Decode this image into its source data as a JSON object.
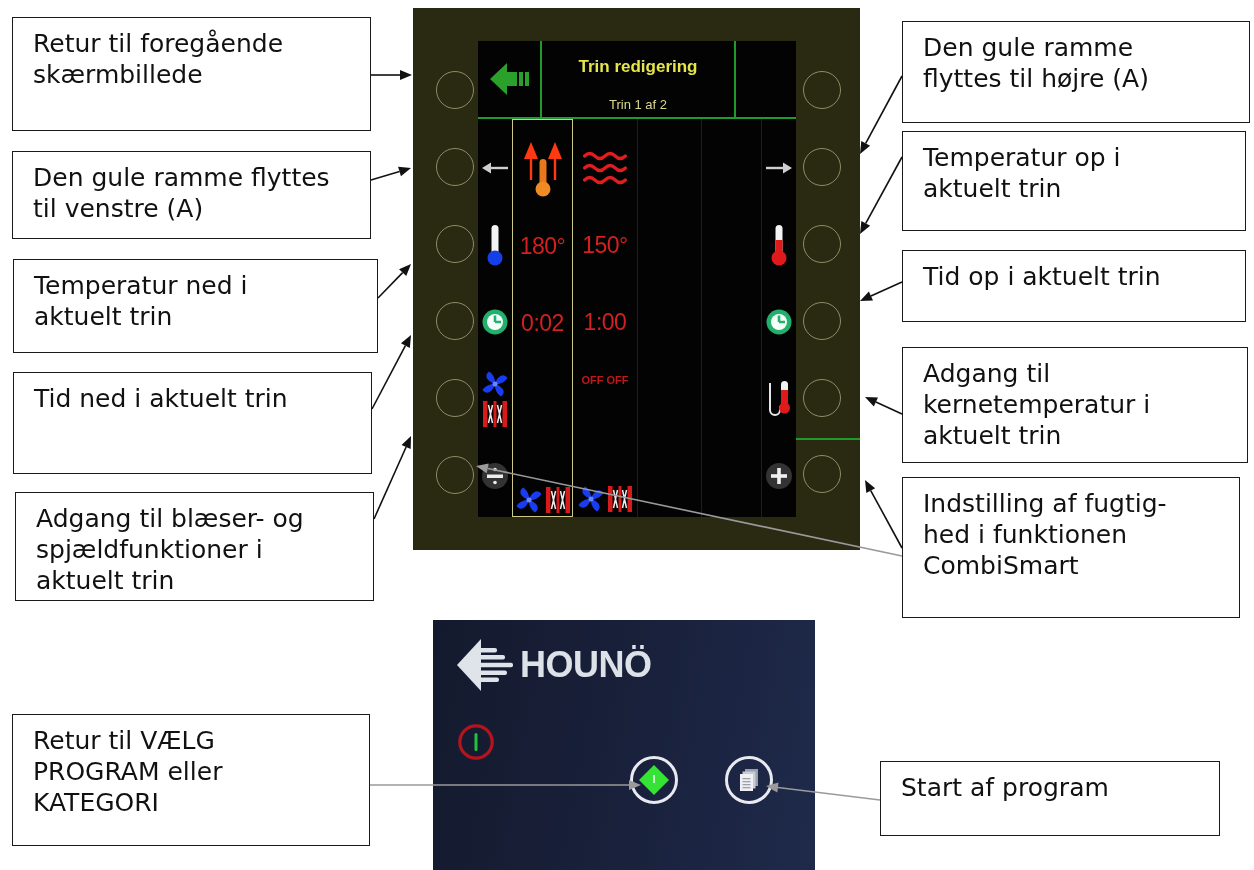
{
  "left_callouts": [
    {
      "lines": [
        "Retur til foregående",
        "skærmbillede"
      ]
    },
    {
      "lines": [
        "Den gule ramme flyttes",
        "til venstre (A)"
      ]
    },
    {
      "lines": [
        "Temperatur ned i",
        "aktuelt trin"
      ]
    },
    {
      "lines": [
        "Tid ned i aktuelt trin"
      ]
    },
    {
      "lines": [
        "Adgang til blæser- og",
        "spjældfunktioner i",
        "aktuelt trin"
      ]
    }
  ],
  "screen": {
    "title": "Trin redigering",
    "subtitle": "Trin 1 af 2",
    "steps": [
      {
        "kind": "heatup",
        "selected": true,
        "temperature": "180°",
        "time": "0:02",
        "fan_damper": true
      },
      {
        "kind": "waves",
        "selected": false,
        "temperature": "150°",
        "time": "1:00",
        "status": "OFF OFF",
        "fan_damper": true
      },
      {
        "selected": false,
        "fan_damper": false
      },
      {
        "selected": false,
        "fan_damper": false
      }
    ]
  },
  "right_callouts": [
    {
      "lines": [
        "Den gule ramme",
        "flyttes til højre (A)"
      ]
    },
    {
      "lines": [
        "Temperatur op i",
        "aktuelt trin"
      ]
    },
    {
      "lines": [
        "Tid op i aktuelt trin"
      ]
    },
    {
      "lines": [
        "Adgang til",
        "kernetemperatur i",
        "aktuelt trin"
      ]
    },
    {
      "lines": [
        "Indstilling af fugtig-",
        "hed i funktionen",
        "CombiSmart"
      ]
    }
  ],
  "start_screen": {
    "brand": "HOUNÖ"
  },
  "bottom_callouts": [
    {
      "lines": [
        "Retur til VÆLG",
        "PROGRAM eller",
        "KATEGORI"
      ]
    },
    {
      "lines": [
        "Start af program"
      ]
    }
  ]
}
